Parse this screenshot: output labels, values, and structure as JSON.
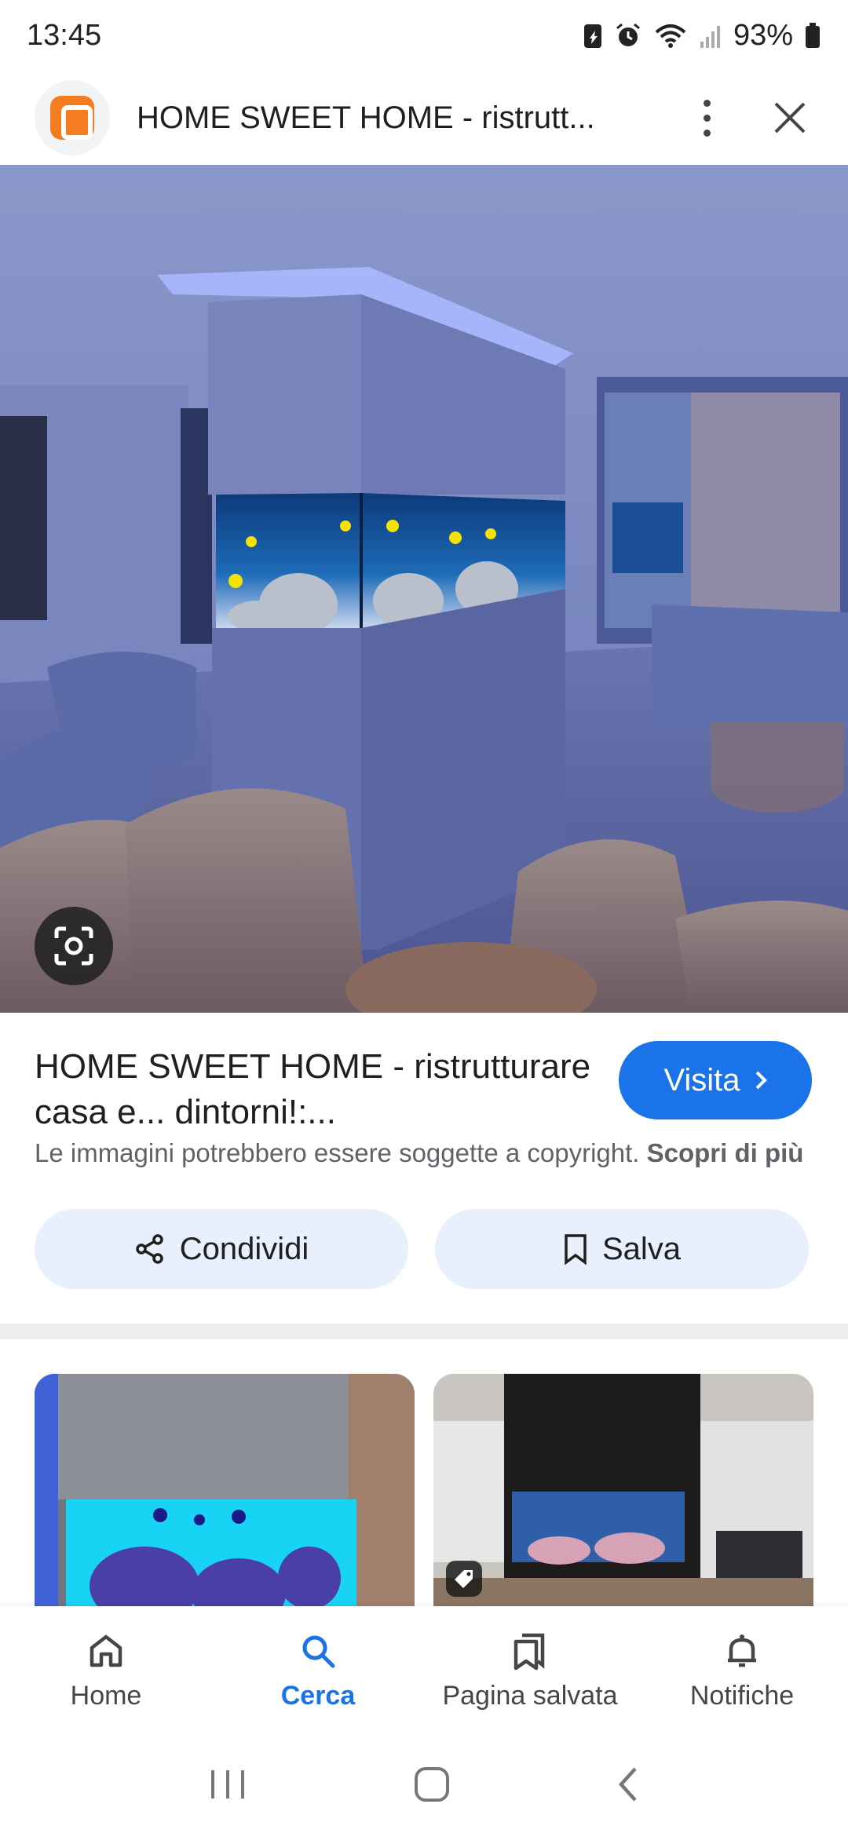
{
  "status_bar": {
    "time": "13:45",
    "battery": "93%",
    "icons": [
      "battery-saver-icon",
      "alarm-icon",
      "wifi-icon",
      "signal-icon",
      "battery-icon"
    ]
  },
  "header": {
    "title": "HOME SWEET HOME - ristrutt...",
    "source_icon": "blogger-icon"
  },
  "result": {
    "title": "HOME SWEET HOME - ristrutturare casa e... dintorni!:...",
    "visit_label": "Visita",
    "copyright_text": "Le immagini potrebbero essere soggette a copyright.",
    "learn_more": "Scopri di più",
    "share_label": "Condividi",
    "save_label": "Salva"
  },
  "bottom_nav": {
    "items": [
      {
        "label": "Home",
        "icon": "home-icon"
      },
      {
        "label": "Cerca",
        "icon": "search-icon"
      },
      {
        "label": "Pagina salvata",
        "icon": "bookmarks-icon"
      },
      {
        "label": "Notifiche",
        "icon": "bell-icon"
      }
    ]
  },
  "colors": {
    "accent": "#1a73e8",
    "chip_bg": "#e8f0fe",
    "blogger": "#f57c20"
  }
}
